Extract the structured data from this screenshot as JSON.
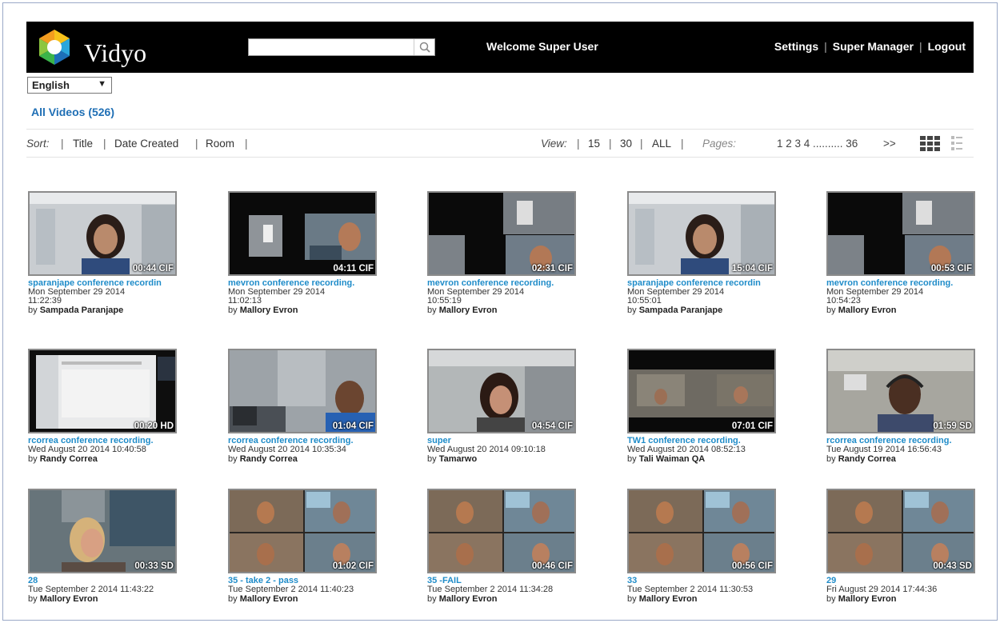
{
  "header": {
    "brand": "Vidyo",
    "search_placeholder": "",
    "welcome": "Welcome Super User",
    "links": [
      "Settings",
      "Super Manager",
      "Logout"
    ]
  },
  "language": "English",
  "all_videos": "All Videos (526)",
  "toolbar": {
    "sort_label": "Sort:",
    "sort_options": [
      "Title",
      "Date Created",
      "Room"
    ],
    "view_label": "View:",
    "view_options": [
      "15",
      "30",
      "ALL"
    ],
    "pages_label": "Pages:",
    "pages_text": "1 2 3 4 .......... 36",
    "next": ">>"
  },
  "videos": [
    {
      "title": "sparanjape conference recordin",
      "date": "Mon September 29 2014 11:22:39",
      "author": "Sampada Paranjape",
      "duration": "00:44 CIF",
      "scene": "office",
      "date_lines": [
        "Mon September 29 2014",
        "11:22:39"
      ]
    },
    {
      "title": "mevron conference recording.",
      "date": "Mon September 29 2014 11:02:13",
      "author": "Mallory Evron",
      "duration": "04:11 CIF",
      "scene": "dual",
      "date_lines": [
        "Mon September 29 2014",
        "11:02:13"
      ]
    },
    {
      "title": "mevron conference recording.",
      "date": "Mon September 29 2014 10:55:19",
      "author": "Mallory Evron",
      "duration": "02:31 CIF",
      "scene": "quad",
      "date_lines": [
        "Mon September 29 2014",
        "10:55:19"
      ]
    },
    {
      "title": "sparanjape conference recordin",
      "date": "Mon September 29 2014 10:55:01",
      "author": "Sampada Paranjape",
      "duration": "15:04 CIF",
      "scene": "office",
      "date_lines": [
        "Mon September 29 2014",
        "10:55:01"
      ]
    },
    {
      "title": "mevron conference recording.",
      "date": "Mon September 29 2014 10:54:23",
      "author": "Mallory Evron",
      "duration": "00:53 CIF",
      "scene": "quad",
      "date_lines": [
        "Mon September 29 2014",
        "10:54:23"
      ]
    },
    {
      "title": "rcorrea conference recording.",
      "date": "Wed August 20 2014 10:40:58",
      "author": "Randy Correa",
      "duration": "00:20 HD",
      "scene": "screen"
    },
    {
      "title": "rcorrea conference recording.",
      "date": "Wed August 20 2014 10:35:34",
      "author": "Randy Correa",
      "duration": "01:04 CIF",
      "scene": "man"
    },
    {
      "title": "super",
      "date": "Wed August 20 2014 09:10:18",
      "author": "Tamarwo",
      "duration": "04:54 CIF",
      "scene": "woman"
    },
    {
      "title": "TW1 conference recording.",
      "date": "Wed August 20 2014 08:52:13",
      "author": "Tali Waiman QA",
      "duration": "07:01 CIF",
      "scene": "room"
    },
    {
      "title": "rcorrea conference recording.",
      "date": "Tue August 19 2014 16:56:43",
      "author": "Randy Correa",
      "duration": "01:59 SD",
      "scene": "man2"
    },
    {
      "title": "28",
      "date": "Tue September 2 2014 11:43:22",
      "author": "Mallory Evron",
      "duration": "00:33 SD",
      "scene": "blonde"
    },
    {
      "title": "35 - take 2 - pass",
      "date": "Tue September 2 2014 11:40:23",
      "author": "Mallory Evron",
      "duration": "01:02 CIF",
      "scene": "multi"
    },
    {
      "title": "35 -FAIL",
      "date": "Tue September 2 2014 11:34:28",
      "author": "Mallory Evron",
      "duration": "00:46 CIF",
      "scene": "multi"
    },
    {
      "title": "33",
      "date": "Tue September 2 2014 11:30:53",
      "author": "Mallory Evron",
      "duration": "00:56 CIF",
      "scene": "multi"
    },
    {
      "title": "29",
      "date": "Fri August 29 2014 17:44:36",
      "author": "Mallory Evron",
      "duration": "00:43 SD",
      "scene": "multi"
    }
  ],
  "by_prefix": "by"
}
